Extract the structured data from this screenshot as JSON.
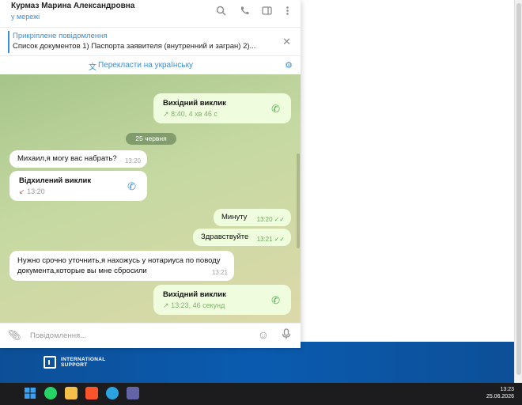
{
  "header": {
    "contact_name": "Курмаз Марина Александровна",
    "status": "у мережі",
    "icons": [
      "search-icon",
      "phone-icon",
      "sidebar-toggle-icon",
      "more-icon"
    ]
  },
  "pinned": {
    "title": "Прикріплене повідомлення",
    "text": "Список документов    1) Паспорта заявителя (внутренний и загран) 2)..."
  },
  "translate": {
    "label": "Перекласти на українську"
  },
  "messages": {
    "call1": {
      "title": "Вихідний виклик",
      "sub": "8:40, 4 хв 46 с"
    },
    "date_divider": "25 червня",
    "msg1": {
      "text": "Михаил,я могу вас набрать?",
      "time": "13:20"
    },
    "call2": {
      "title": "Відхилений виклик",
      "time": "13:20"
    },
    "msg2": {
      "text": "Минуту",
      "time": "13:20"
    },
    "msg3": {
      "text": "Здравствуйте",
      "time": "13:21"
    },
    "msg4": {
      "line1": "Нужно срочно уточнить,я нахожусь у нотариуса по поводу",
      "line2": "документа,которые вы мне сбросили",
      "time": "13:21"
    },
    "call3": {
      "title": "Вихідний виклик",
      "sub": "13:23, 46 секунд"
    }
  },
  "input": {
    "placeholder": "Повідомлення..."
  },
  "banner": {
    "logo_line1": "INTERNATIONAL",
    "logo_line2": "SUPPORT"
  },
  "taskbar": {
    "time": "13:23",
    "date": "25.06.2026",
    "apps": [
      "windows-start-icon",
      "whatsapp-icon",
      "file-explorer-icon",
      "brave-browser-icon",
      "telegram-icon",
      "teams-icon"
    ]
  },
  "colors": {
    "accent": "#3a8fd8",
    "outgoing_bubble": "#effdde",
    "call_green": "#4fae4e",
    "missed_red": "#d9534f",
    "banner_blue": "#0a5bb0"
  }
}
